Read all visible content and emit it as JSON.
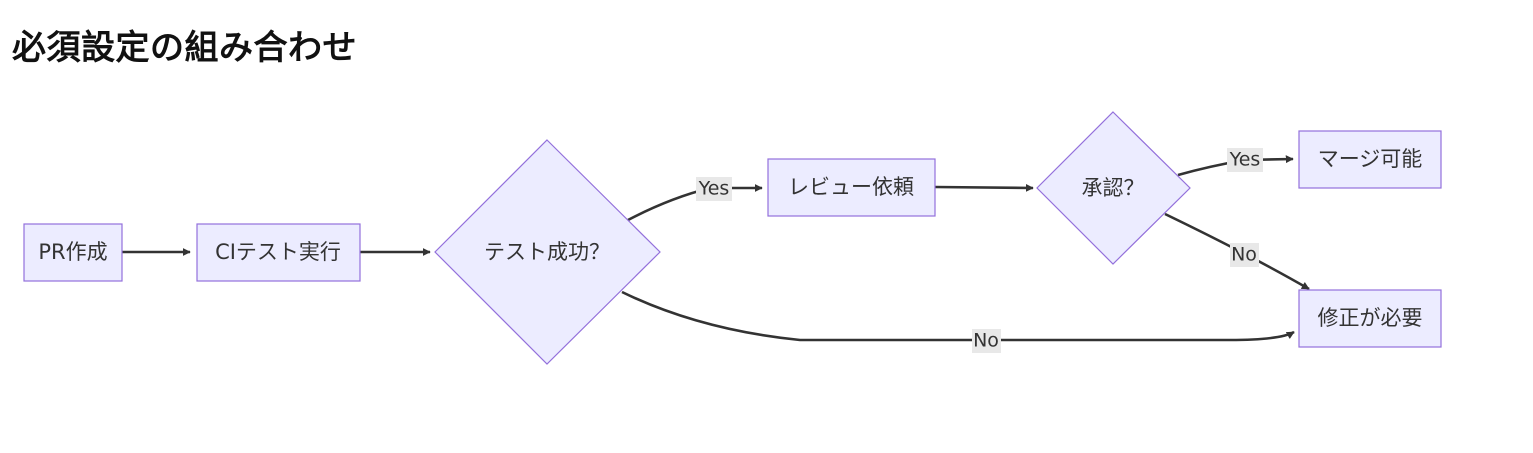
{
  "title": "必須設定の組み合わせ",
  "nodes": {
    "pr": "PR作成",
    "ci": "CIテスト実行",
    "test": "テスト成功？",
    "review": "レビュー依頼",
    "approve": "承認？",
    "merge": "マージ可能",
    "fix": "修正が必要"
  },
  "edges": {
    "test_yes": "Yes",
    "test_no": "No",
    "approve_yes": "Yes",
    "approve_no": "No"
  },
  "colors": {
    "node_fill": "#ececff",
    "node_stroke": "#9370db",
    "edge": "#333333",
    "edge_label_bg": "#e8e8e8"
  }
}
